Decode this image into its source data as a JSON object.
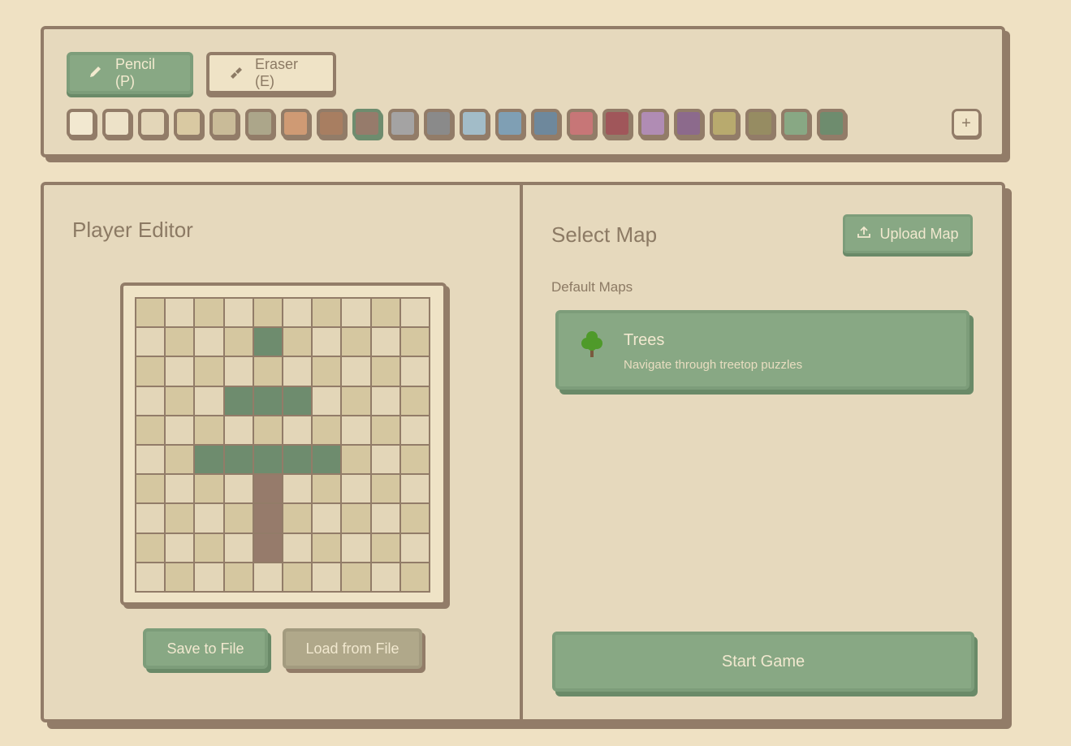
{
  "toolbar": {
    "pencil_label": "Pencil (P)",
    "eraser_label": "Eraser (E)",
    "add_color_label": "+",
    "palette": [
      "#f2e8d0",
      "#ede2c8",
      "#e3d6b8",
      "#d9c9a2",
      "#c9bb98",
      "#aca68a",
      "#cf9a74",
      "#a87e61",
      "#967b6b",
      "#a4a3a3",
      "#8a8a8a",
      "#a2bcc8",
      "#7f9fb4",
      "#6e889c",
      "#c77677",
      "#a0565a",
      "#b08cb4",
      "#8c6a8c",
      "#b8aa6e",
      "#968c62",
      "#88a884",
      "#6e8c6e"
    ],
    "selected_index": 8
  },
  "player_editor": {
    "title": "Player Editor",
    "grid": [
      "..........",
      "....G.....",
      "..........",
      "...GGG....",
      "..........",
      "..GGGGG...",
      "....B.....",
      "....B.....",
      "....B.....",
      ".........."
    ],
    "colors": {
      "light": "#e3d6b8",
      "dark": "#d5c7a0",
      "G": "#6e8c6e",
      "B": "#967b6b"
    },
    "save_label": "Save to File",
    "load_label": "Load from File"
  },
  "map_select": {
    "title": "Select Map",
    "upload_label": "Upload Map",
    "section_label": "Default Maps",
    "maps": [
      {
        "name": "Trees",
        "description": "Navigate through treetop puzzles",
        "icon": "tree-icon"
      }
    ],
    "start_label": "Start Game"
  }
}
